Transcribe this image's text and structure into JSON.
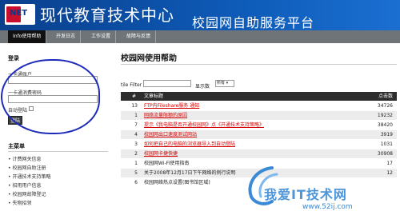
{
  "header": {
    "logo_text": "NET",
    "title_main": "现代教育技术中心",
    "title_sub": "校园网自助服务平台"
  },
  "nav": {
    "items": [
      {
        "label": "Info使用帮助",
        "active": true
      },
      {
        "label": "开发日志"
      },
      {
        "label": "工作设置"
      },
      {
        "label": "故障与反馈"
      }
    ]
  },
  "login": {
    "title": "登录",
    "account_label": "一卡通账户",
    "password_label": "一卡通消费密码",
    "account_value": "",
    "password_value": "",
    "auto_login_label": "自动登陆",
    "login_button": "登陆"
  },
  "menu": {
    "title": "主菜单",
    "items": [
      "• 计费网关信息",
      "• 校园网自助注册",
      "• 开通技术支持策略",
      "• 招用用户信息",
      "• 校园网故障登记",
      "• 失物招领"
    ]
  },
  "main": {
    "title": "校园网使用帮助",
    "filter_label": "tile Filter",
    "filter_value": "",
    "show_label": "显示数",
    "show_value": "所有 ▾",
    "table": {
      "headers": {
        "number": "#",
        "title": "文章标题",
        "count": "点击数"
      },
      "rows": [
        {
          "num": "13",
          "title": "FTP内Fileshare服务 通知",
          "count": "34726",
          "red": true
        },
        {
          "num": "1",
          "title": "网络流量限额的原因",
          "count": "19232",
          "red": true
        },
        {
          "num": "7",
          "title": "提示《我电脑是否开通校园网》点《开通技术支持策略》",
          "count": "38420",
          "red": true
        },
        {
          "num": "4",
          "title": "校园网出口速度测试网站",
          "count": "3919",
          "red": true
        },
        {
          "num": "3",
          "title": "如何把自己的电脑的浏览器导入到自动登陆",
          "count": "1031",
          "red": true
        },
        {
          "num": "2",
          "title": "校园网卡捷快捷",
          "count": "30908",
          "red": true
        },
        {
          "num": "1",
          "title": "校园网Wi-Fi使用指南",
          "count": "17",
          "red": false
        },
        {
          "num": "5",
          "title": "关于2008年12月17日下午网络的例行说明",
          "count": "12",
          "red": false
        },
        {
          "num": "6",
          "title": "校园网络热点设置(图书馆区域)",
          "count": "",
          "red": false
        }
      ]
    }
  },
  "watermark": {
    "text": "我爱IT技术网",
    "url": "www.52ij.com"
  }
}
